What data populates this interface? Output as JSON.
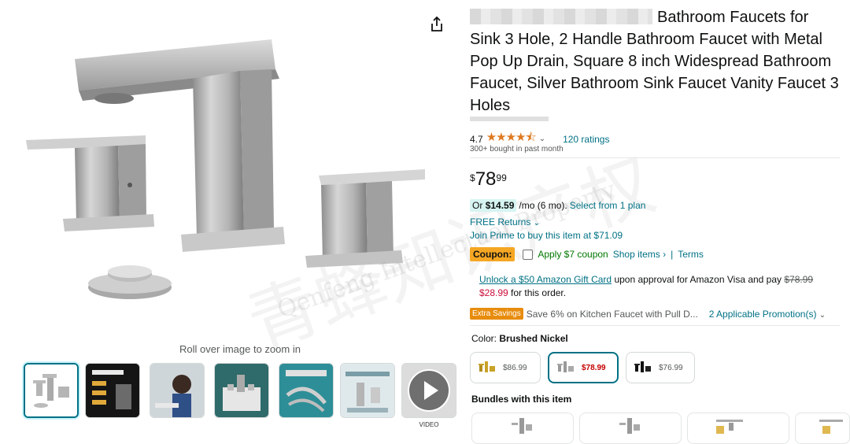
{
  "gallery": {
    "zoom_hint": "Roll over image to zoom in",
    "video_label": "VIDEO",
    "watermark": {
      "line1": "青蜂知识产权",
      "line2": "Qenfeng Intellectual Property"
    }
  },
  "product": {
    "title": "Bathroom Faucets for Sink 3 Hole, 2 Handle Bathroom Faucet with Metal Pop Up Drain, Square 8 inch Widespread Bathroom Faucet, Silver Bathroom Sink Faucet Vanity Faucet 3 Holes",
    "rating_value": "4.7",
    "stars": "★★★★⯪",
    "ratings_count": "120 ratings",
    "bought": "300+ bought in past month",
    "price": {
      "symbol": "$",
      "whole": "78",
      "fraction": "99"
    },
    "monthly": {
      "prefix": "Or",
      "amount": "$14.59",
      "term": "/mo (6 mo).",
      "plan_link": "Select from 1 plan"
    },
    "free_returns": "FREE Returns",
    "prime": "Join Prime to buy this item at $71.09",
    "coupon": {
      "badge": "Coupon:",
      "text": "Apply $7 coupon",
      "shop": "Shop items ›",
      "sep": "|",
      "terms": "Terms"
    },
    "gift": {
      "link": "Unlock a $50 Amazon Gift Card",
      "text1": "upon approval for Amazon Visa and pay",
      "old_price": "$78.99",
      "new_price": "$28.99",
      "text2": "for this order."
    },
    "extra": {
      "badge": "Extra Savings",
      "text": "Save 6% on Kitchen Faucet with Pull D...",
      "promo": "2 Applicable Promotion(s)"
    },
    "color": {
      "label": "Color:",
      "value": "Brushed Nickel"
    },
    "swatches": [
      {
        "price": "$86.99"
      },
      {
        "price": "$78.99"
      },
      {
        "price": "$76.99"
      }
    ],
    "bundles_label": "Bundles with this item"
  },
  "colors": {
    "link": "#007185",
    "star": "#de7921",
    "price_red": "#cc0c39",
    "coupon_badge": "#f5a623"
  }
}
